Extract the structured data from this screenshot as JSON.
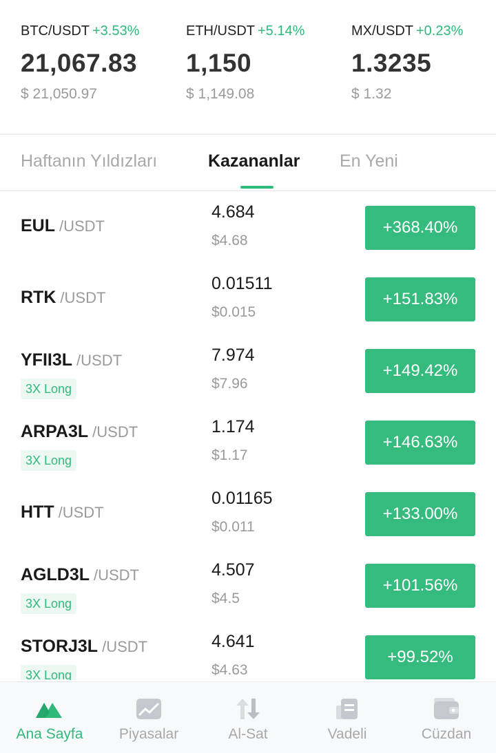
{
  "tickers": [
    {
      "pair": "BTC/USDT",
      "change": "+3.53%",
      "price": "21,067.83",
      "usd": "$ 21,050.97"
    },
    {
      "pair": "ETH/USDT",
      "change": "+5.14%",
      "price": "1,150",
      "usd": "$ 1,149.08"
    },
    {
      "pair": "MX/USDT",
      "change": "+0.23%",
      "price": "1.3235",
      "usd": "$ 1.32"
    }
  ],
  "tabs": [
    {
      "label": "Haftanın Yıldızları"
    },
    {
      "label": "Kazananlar"
    },
    {
      "label": "En Yeni"
    }
  ],
  "active_tab": "Kazananlar",
  "list": [
    {
      "base": "EUL",
      "quote": "/USDT",
      "badge": "",
      "price": "4.684",
      "usd": "$4.68",
      "change": "+368.40%"
    },
    {
      "base": "RTK",
      "quote": "/USDT",
      "badge": "",
      "price": "0.01511",
      "usd": "$0.015",
      "change": "+151.83%"
    },
    {
      "base": "YFII3L",
      "quote": "/USDT",
      "badge": "3X Long",
      "price": "7.974",
      "usd": "$7.96",
      "change": "+149.42%"
    },
    {
      "base": "ARPA3L",
      "quote": "/USDT",
      "badge": "3X Long",
      "price": "1.174",
      "usd": "$1.17",
      "change": "+146.63%"
    },
    {
      "base": "HTT",
      "quote": "/USDT",
      "badge": "",
      "price": "0.01165",
      "usd": "$0.011",
      "change": "+133.00%"
    },
    {
      "base": "AGLD3L",
      "quote": "/USDT",
      "badge": "3X Long",
      "price": "4.507",
      "usd": "$4.5",
      "change": "+101.56%"
    },
    {
      "base": "STORJ3L",
      "quote": "/USDT",
      "badge": "3X Long",
      "price": "4.641",
      "usd": "$4.63",
      "change": "+99.52%"
    }
  ],
  "nav": [
    {
      "label": "Ana Sayfa",
      "icon": "home-mountain-icon",
      "active": true
    },
    {
      "label": "Piyasalar",
      "icon": "markets-chart-icon",
      "active": false
    },
    {
      "label": "Al-Sat",
      "icon": "trade-arrows-icon",
      "active": false
    },
    {
      "label": "Vadeli",
      "icon": "futures-document-icon",
      "active": false
    },
    {
      "label": "Cüzdan",
      "icon": "wallet-icon",
      "active": false
    }
  ],
  "colors": {
    "accent": "#2fb97a",
    "button": "#35bb7e",
    "muted": "#9a9a9a",
    "text": "#1a1a1a"
  }
}
